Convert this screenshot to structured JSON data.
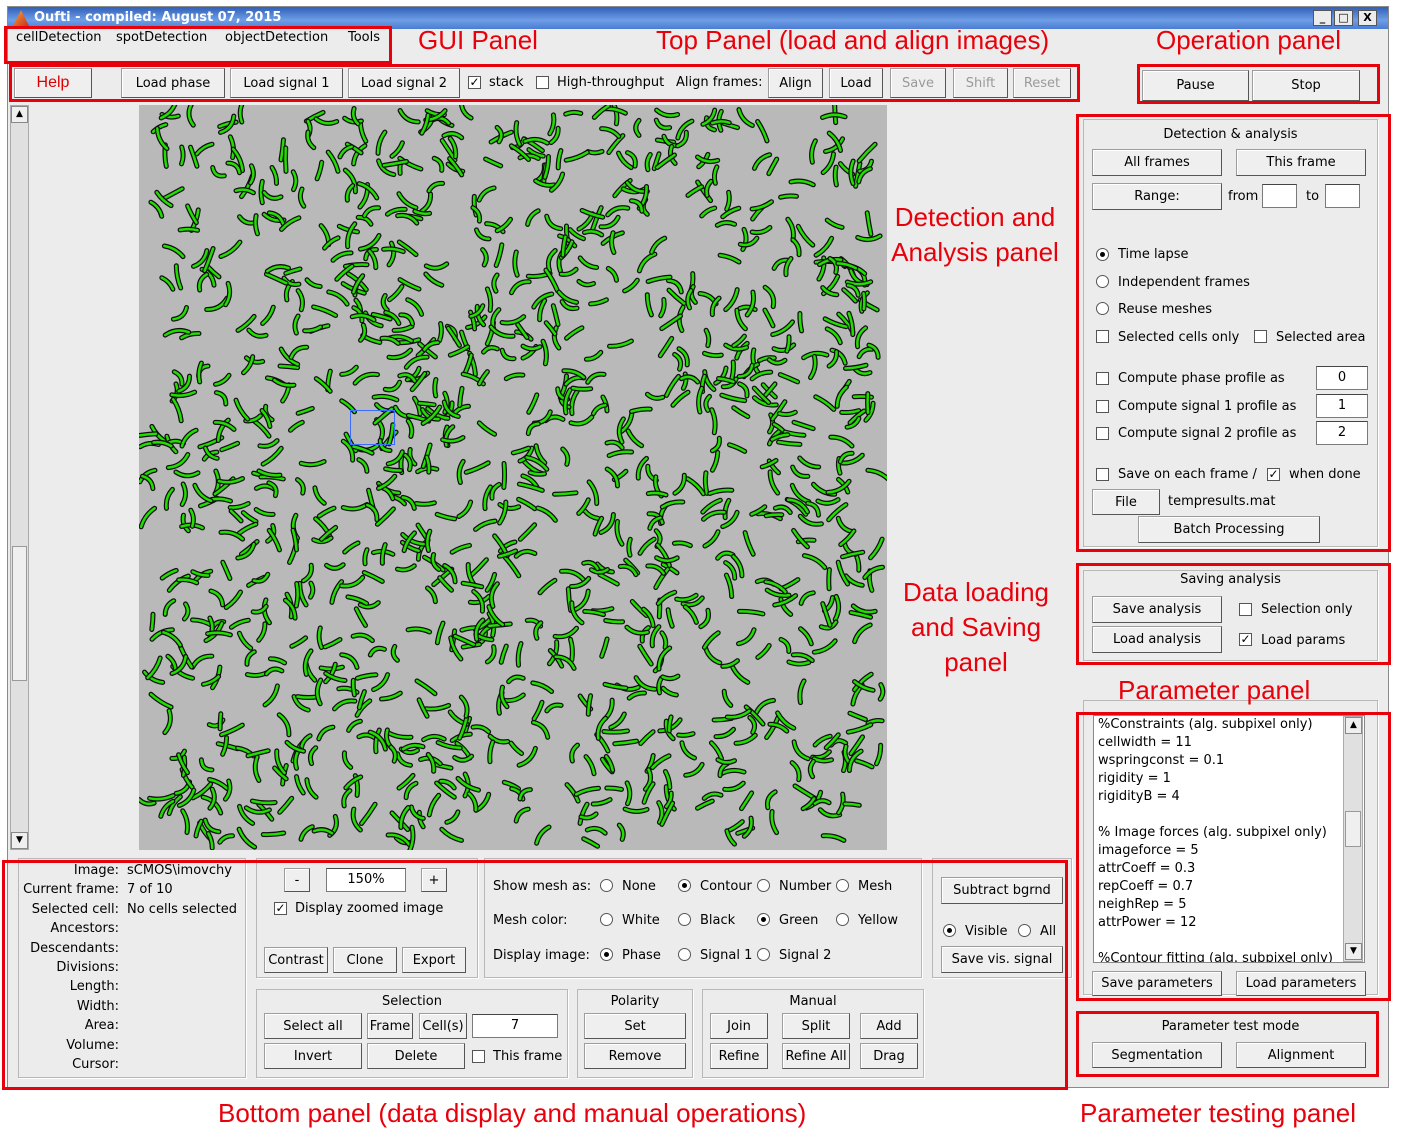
{
  "window": {
    "title": "Oufti - compiled: August 07, 2015",
    "min": "_",
    "max": "□",
    "close": "X"
  },
  "menu": [
    "cellDetection",
    "spotDetection",
    "objectDetection",
    "Tools"
  ],
  "top": {
    "help": "Help",
    "load_phase": "Load phase",
    "load_signal1": "Load signal 1",
    "load_signal2": "Load signal 2",
    "stack": "stack",
    "stack_checked": true,
    "high_throughput": "High-throughput",
    "high_throughput_checked": false,
    "align_frames": "Align frames:",
    "align": "Align",
    "load": "Load",
    "save": "Save",
    "shift": "Shift",
    "reset": "Reset"
  },
  "operation": {
    "pause": "Pause",
    "stop": "Stop"
  },
  "detection": {
    "title": "Detection & analysis",
    "all_frames": "All frames",
    "this_frame": "This frame",
    "range": "Range:",
    "from": "from",
    "to": "to",
    "from_value": "",
    "to_value": "",
    "time_lapse": "Time lapse",
    "independent_frames": "Independent frames",
    "reuse_meshes": "Reuse meshes",
    "selected_cells_only": "Selected cells only",
    "selected_area": "Selected area",
    "phase_profile": "Compute phase profile as",
    "phase_value": "0",
    "signal1_profile": "Compute signal 1 profile as",
    "signal1_value": "1",
    "signal2_profile": "Compute signal 2 profile as",
    "signal2_value": "2",
    "save_each_frame": "Save on each frame /",
    "when_done": "when done",
    "file": "File",
    "filename": "tempresults.mat",
    "batch": "Batch Processing"
  },
  "saving": {
    "title": "Saving analysis",
    "save_analysis": "Save analysis",
    "load_analysis": "Load analysis",
    "selection_only": "Selection only",
    "load_params": "Load params"
  },
  "parameters": {
    "lines": [
      "%Constraints (alg. subpixel only)",
      "cellwidth = 11",
      "wspringconst = 0.1",
      "rigidity = 1",
      "rigidityB = 4",
      "",
      "% Image forces (alg. subpixel only)",
      "imageforce = 5",
      "attrCoeff = 0.3",
      "repCoeff = 0.7",
      "neighRep = 5",
      "attrPower = 12",
      "",
      "%Contour fitting (alg. subpixel only)"
    ],
    "save": "Save parameters",
    "load": "Load parameters"
  },
  "test_mode": {
    "title": "Parameter test mode",
    "segmentation": "Segmentation",
    "alignment": "Alignment"
  },
  "info": {
    "labels": [
      "Image:",
      "Current frame:",
      "Selected cell:",
      "Ancestors:",
      "Descendants:",
      "Divisions:",
      "Length:",
      "Width:",
      "Area:",
      "Volume:",
      "Cursor:"
    ],
    "values": [
      "sCMOS\\imovchy",
      "7 of 10",
      "No cells selected",
      "",
      "",
      "",
      "",
      "",
      "",
      "",
      ""
    ]
  },
  "zoom": {
    "minus": "-",
    "value": "150%",
    "plus": "+",
    "display_zoomed": "Display zoomed image",
    "contrast": "Contrast",
    "clone": "Clone",
    "export": "Export"
  },
  "display": {
    "show_mesh_as": "Show mesh as:",
    "mesh_options": [
      "None",
      "Contour",
      "Number",
      "Mesh"
    ],
    "mesh_color": "Mesh color:",
    "color_options": [
      "White",
      "Black",
      "Green",
      "Yellow"
    ],
    "display_image": "Display image:",
    "image_options": [
      "Phase",
      "Signal 1",
      "Signal 2"
    ],
    "subtract_bgrnd": "Subtract bgrnd",
    "visible": "Visible",
    "all": "All",
    "save_vis_signal": "Save vis. signal"
  },
  "selection": {
    "title": "Selection",
    "select_all": "Select all",
    "frame": "Frame",
    "cells": "Cell(s)",
    "cell_value": "7",
    "invert": "Invert",
    "delete": "Delete",
    "this_frame": "This frame"
  },
  "polarity": {
    "title": "Polarity",
    "set": "Set",
    "remove": "Remove"
  },
  "manual": {
    "title": "Manual",
    "join": "Join",
    "split": "Split",
    "add": "Add",
    "refine": "Refine",
    "refine_all": "Refine All",
    "drag": "Drag"
  },
  "annotations": {
    "gui": "GUI Panel",
    "top": "Top Panel (load and align images)",
    "operation": "Operation panel",
    "detection": "Detection and Analysis panel",
    "data": "Data loading and Saving panel",
    "parameter": "Parameter panel",
    "bottom": "Bottom panel (data display and manual operations)",
    "testing": "Parameter testing panel"
  },
  "colors": {
    "annotation": "#e8000b",
    "mesh": "#22dd00",
    "background": "#ececec"
  }
}
